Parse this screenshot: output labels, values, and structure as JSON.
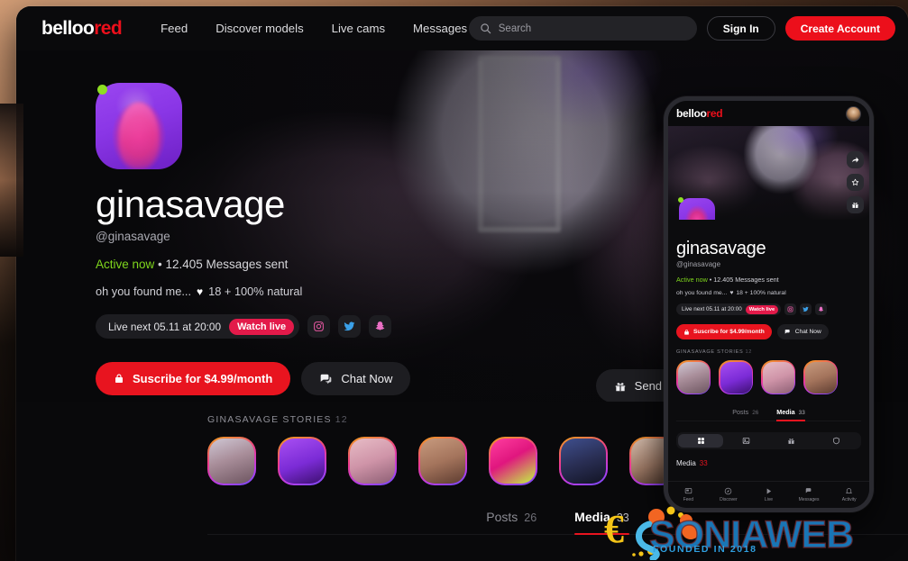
{
  "header": {
    "logo_white": "belloo",
    "logo_red": "red",
    "nav": [
      {
        "label": "Feed",
        "name": "nav-feed"
      },
      {
        "label": "Discover models",
        "name": "nav-discover-models"
      },
      {
        "label": "Live cams",
        "name": "nav-live-cams"
      },
      {
        "label": "Messages",
        "name": "nav-messages"
      }
    ],
    "search_placeholder": "Search",
    "sign_in_label": "Sign In",
    "create_account_label": "Create Account"
  },
  "profile": {
    "display_name": "ginasavage",
    "handle": "@ginasavage",
    "status_active": "Active now",
    "status_rest": " • 12.405 Messages sent",
    "bio_prefix": "oh you found me...",
    "bio_heart": "♥",
    "bio_suffix": "18 + 100% natural",
    "live_text": "Live next 05.11 at 20:00",
    "watch_live_label": "Watch live",
    "subscribe_label": "Suscribe for $4.99/month",
    "chat_label": "Chat Now",
    "gift_label": "Send gift",
    "online": true
  },
  "stories": {
    "title": "GINASAVAGE STORIES",
    "count": "12",
    "items": [
      {
        "name": "story-1",
        "tone": "s1"
      },
      {
        "name": "story-2",
        "tone": "s2"
      },
      {
        "name": "story-3",
        "tone": "s3"
      },
      {
        "name": "story-4",
        "tone": "s4"
      },
      {
        "name": "story-5",
        "tone": "s5"
      },
      {
        "name": "story-6",
        "tone": "s6"
      },
      {
        "name": "story-7",
        "tone": "s7"
      }
    ]
  },
  "tabs": [
    {
      "label": "Posts",
      "count": "26",
      "active": false
    },
    {
      "label": "Media",
      "count": "33",
      "active": true
    }
  ],
  "phone": {
    "logo_white": "belloo",
    "logo_red": "red",
    "side_actions": [
      {
        "name": "share-icon"
      },
      {
        "name": "star-icon"
      },
      {
        "name": "gift-icon"
      }
    ],
    "media_label": "Media",
    "media_count": "33",
    "filters": [
      {
        "name": "grid-icon",
        "active": true
      },
      {
        "name": "image-icon",
        "active": false
      },
      {
        "name": "gift-icon",
        "active": false
      },
      {
        "name": "shield-icon",
        "active": false
      }
    ],
    "bottom_nav": [
      {
        "label": "Feed",
        "name": "nav-feed"
      },
      {
        "label": "Discover",
        "name": "nav-discover"
      },
      {
        "label": "Live",
        "name": "nav-live"
      },
      {
        "label": "Messages",
        "name": "nav-messages"
      },
      {
        "label": "Activity",
        "name": "nav-activity"
      }
    ]
  },
  "watermark": {
    "brand": "SONIAWEB",
    "tagline": "FOUNDED IN 2018"
  },
  "colors": {
    "brand_red": "#ec0f1b",
    "cta_red": "#e8141f",
    "watch_live": "#e31a4a",
    "online_green": "#8ede22",
    "active_green": "#7fd61d",
    "watermark_blue": "#2f9fe0",
    "watermark_orange": "#f26522",
    "watermark_yellow": "#f5c518"
  }
}
